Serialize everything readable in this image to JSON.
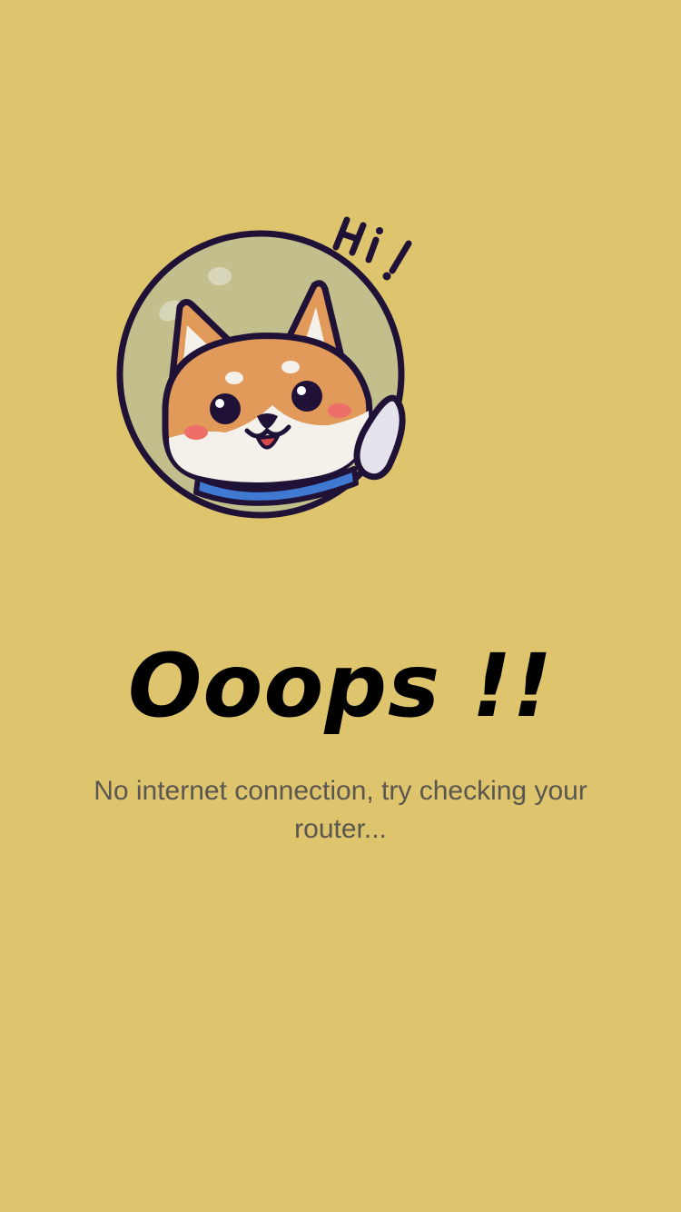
{
  "screen": {
    "background_color": "#DEC46C"
  },
  "illustration": {
    "icon": "shiba-astronaut-icon",
    "greeting_text": "Hi!"
  },
  "headline": "Ooops !!",
  "message": "No internet connection, try checking your router...",
  "colors": {
    "message_text": "#5A5650",
    "headline_text": "#000000",
    "helmet_glass": "#C2BF8D",
    "fur_orange": "#E19A5A",
    "outline": "#1F1236",
    "collar_blue": "#3F79D2"
  }
}
